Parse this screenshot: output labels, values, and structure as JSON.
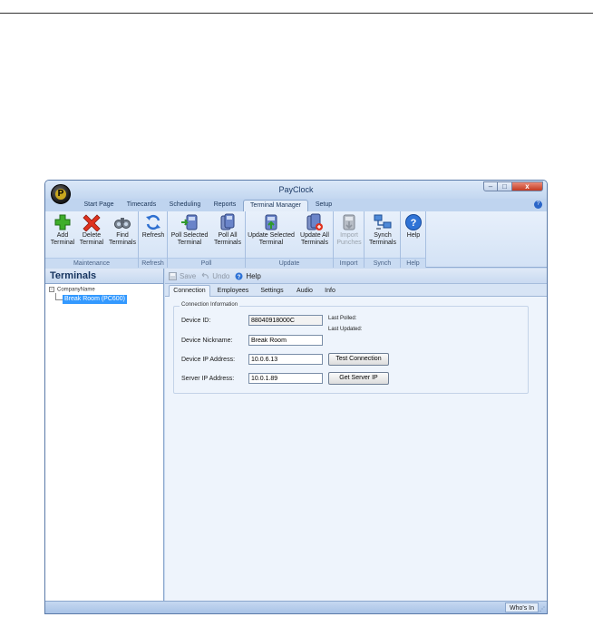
{
  "window": {
    "title": "PayClock"
  },
  "ribbon_tabs": [
    {
      "label": "Start Page",
      "active": false
    },
    {
      "label": "Timecards",
      "active": false
    },
    {
      "label": "Scheduling",
      "active": false
    },
    {
      "label": "Reports",
      "active": false
    },
    {
      "label": "Terminal Manager",
      "active": true
    },
    {
      "label": "Setup",
      "active": false
    }
  ],
  "ribbon": {
    "groups": {
      "maintenance": "Maintenance",
      "refresh": "Refresh",
      "poll": "Poll",
      "update": "Update",
      "import": "Import",
      "synch": "Synch",
      "help": "Help"
    },
    "buttons": {
      "add_terminal": "Add\nTerminal",
      "delete_terminal": "Delete\nTerminal",
      "find_terminals": "Find\nTerminals",
      "refresh": "Refresh",
      "poll_selected": "Poll Selected\nTerminal",
      "poll_all": "Poll All\nTerminals",
      "update_selected": "Update Selected\nTerminal",
      "update_all": "Update All\nTerminals",
      "import_punches": "Import\nPunches",
      "synch_terminals": "Synch\nTerminals",
      "help": "Help"
    }
  },
  "left_panel": {
    "title": "Terminals",
    "tree_root": "CompanyName",
    "tree_child": "Break Room (PC600)"
  },
  "toolbar": {
    "save": "Save",
    "undo": "Undo",
    "help": "Help"
  },
  "subtabs": [
    "Connection",
    "Employees",
    "Settings",
    "Audio",
    "Info"
  ],
  "connection": {
    "legend": "Connection Information",
    "device_id_label": "Device ID:",
    "device_id_value": "88040918000C",
    "nickname_label": "Device Nickname:",
    "nickname_value": "Break Room",
    "device_ip_label": "Device IP Address:",
    "device_ip_value": "10.0.6.13",
    "server_ip_label": "Server IP Address:",
    "server_ip_value": "10.0.1.89",
    "test_connection": "Test Connection",
    "get_server_ip": "Get Server IP",
    "last_polled": "Last Polled:",
    "last_updated": "Last Updated:"
  },
  "statusbar": {
    "whos_in": "Who's In"
  },
  "colors": {
    "accent": "#3399ff",
    "chrome": "#c8daf0",
    "close": "#c43a21"
  }
}
